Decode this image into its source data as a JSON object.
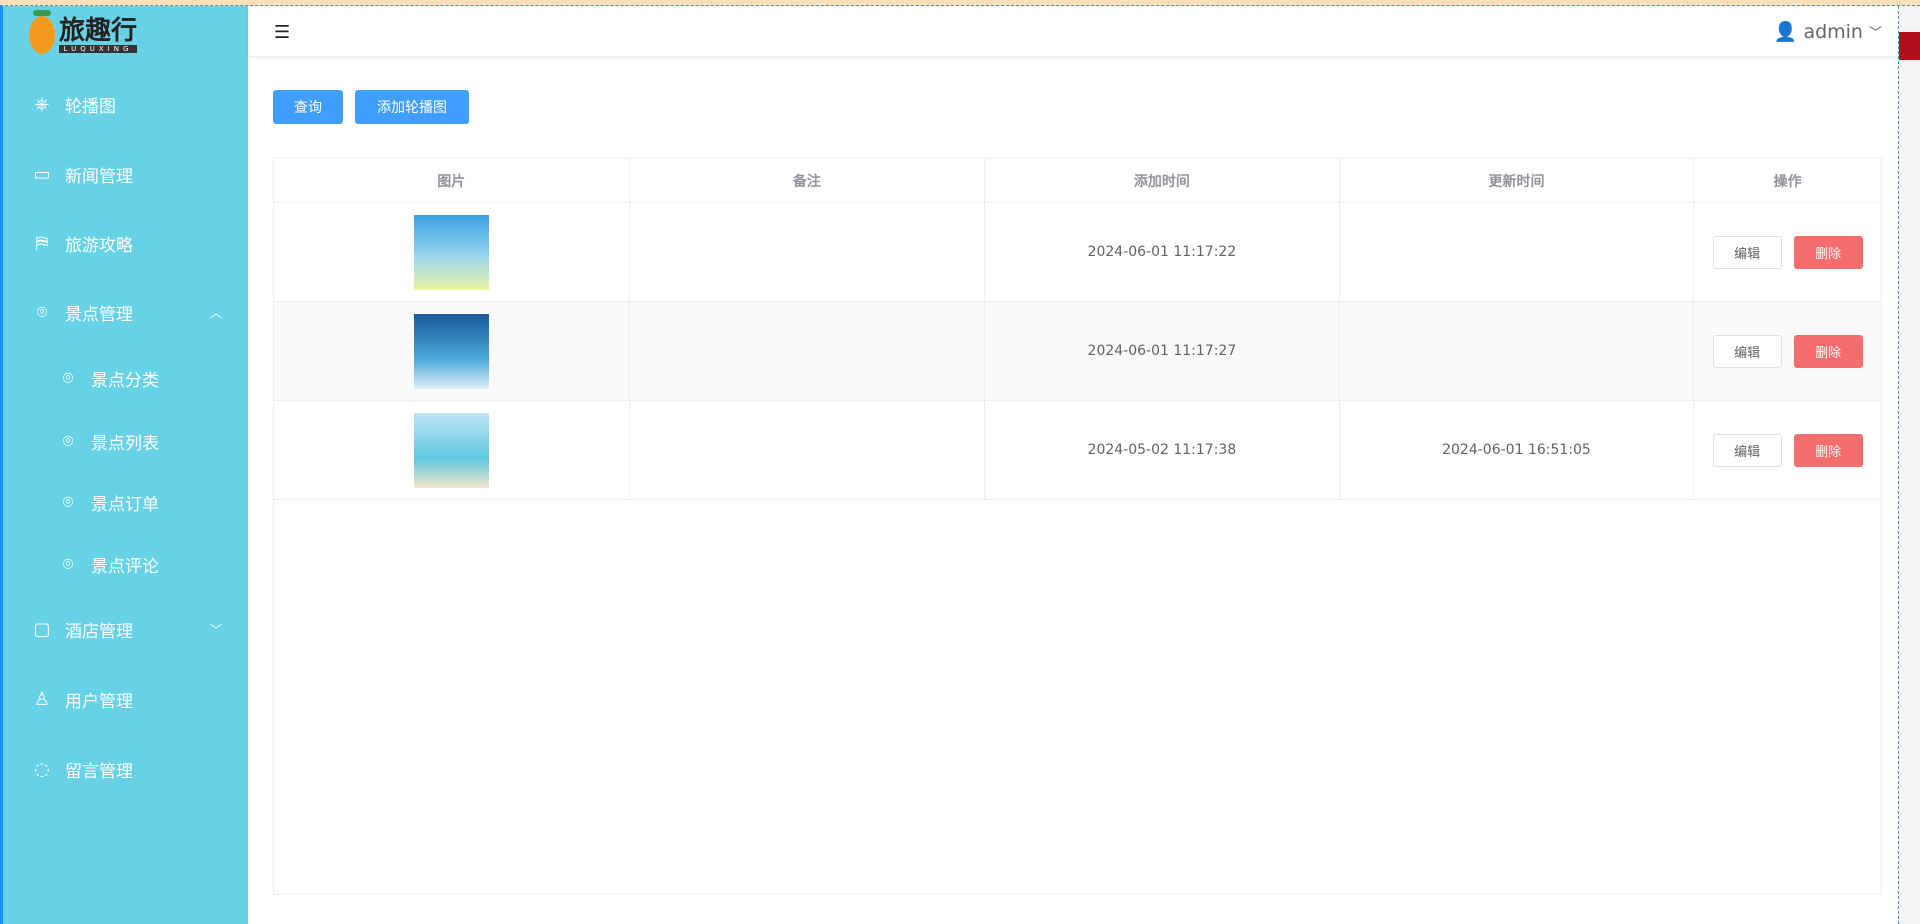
{
  "logo": {
    "title": "旅趣行",
    "subtitle": "LUQUXING"
  },
  "sidebar": {
    "items": [
      {
        "label": "轮播图",
        "icon": "wheel-icon"
      },
      {
        "label": "新闻管理",
        "icon": "news-icon"
      },
      {
        "label": "旅游攻略",
        "icon": "guide-icon"
      },
      {
        "label": "景点管理",
        "icon": "location-icon",
        "expanded": true
      },
      {
        "label": "景点分类",
        "icon": "location-icon"
      },
      {
        "label": "景点列表",
        "icon": "location-icon"
      },
      {
        "label": "景点订单",
        "icon": "location-icon"
      },
      {
        "label": "景点评论",
        "icon": "location-icon"
      },
      {
        "label": "酒店管理",
        "icon": "briefcase-icon",
        "expanded": false
      },
      {
        "label": "用户管理",
        "icon": "user-icon"
      },
      {
        "label": "留言管理",
        "icon": "chat-icon"
      }
    ]
  },
  "header": {
    "user": "admin"
  },
  "toolbar": {
    "query": "查询",
    "add": "添加轮播图"
  },
  "table": {
    "columns": [
      "图片",
      "备注",
      "添加时间",
      "更新时间",
      "操作"
    ],
    "rows": [
      {
        "note": "",
        "created": "2024-06-01 11:17:22",
        "updated": ""
      },
      {
        "note": "",
        "created": "2024-06-01 11:17:27",
        "updated": ""
      },
      {
        "note": "",
        "created": "2024-05-02 11:17:38",
        "updated": "2024-06-01 16:51:05"
      }
    ],
    "edit": "编辑",
    "delete": "删除"
  },
  "colors": {
    "sidebar": "#67d2e6",
    "primary": "#409eff",
    "danger": "#f56c6c"
  }
}
